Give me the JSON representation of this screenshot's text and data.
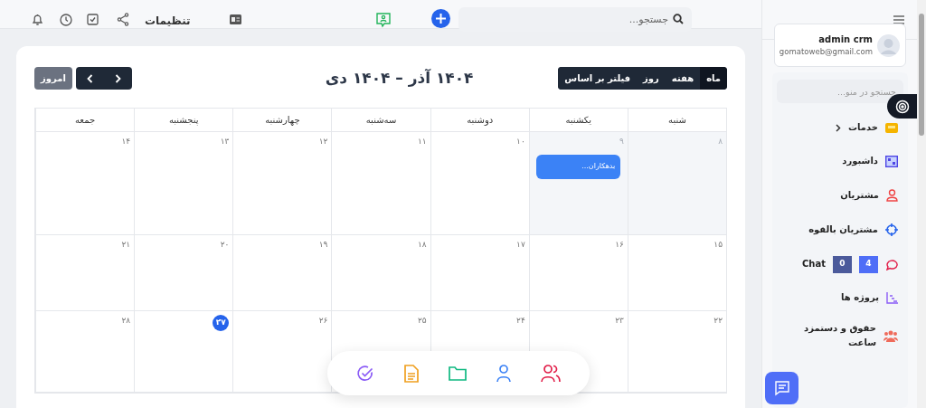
{
  "topbar": {
    "search": {
      "placeholder": "جستجو..."
    },
    "settings_label": "تنظیمات"
  },
  "calendar": {
    "title": "۱۴۰۴ آذر – ۱۴۰۴ دی",
    "today_button": {
      "label": "امروز",
      "disabled": true
    },
    "views": [
      {
        "label": "ماه",
        "selected": true
      },
      {
        "label": "هفته",
        "selected": false
      },
      {
        "label": "روز",
        "selected": false
      },
      {
        "label": "فیلتر بر اساس",
        "selected": false
      }
    ],
    "weekdays": [
      "شنبه",
      "یکشنبه",
      "دوشنبه",
      "سه‌شنبه",
      "چهارشنبه",
      "پنجشنبه",
      "جمعه"
    ],
    "weeks": [
      [
        {
          "day": "۸",
          "muted": true,
          "today": false
        },
        {
          "day": "۹",
          "muted": true,
          "today": false,
          "events": [
            "بدهکاران..."
          ]
        },
        {
          "day": "۱۰",
          "muted": false,
          "today": false
        },
        {
          "day": "۱۱",
          "muted": false,
          "today": false
        },
        {
          "day": "۱۲",
          "muted": false,
          "today": false
        },
        {
          "day": "۱۳",
          "muted": false,
          "today": false
        },
        {
          "day": "۱۴",
          "muted": false,
          "today": false
        }
      ],
      [
        {
          "day": "۱۵",
          "muted": false,
          "today": false
        },
        {
          "day": "۱۶",
          "muted": false,
          "today": false
        },
        {
          "day": "۱۷",
          "muted": false,
          "today": false
        },
        {
          "day": "۱۸",
          "muted": false,
          "today": false
        },
        {
          "day": "۱۹",
          "muted": false,
          "today": false
        },
        {
          "day": "۲۰",
          "muted": false,
          "today": false
        },
        {
          "day": "۲۱",
          "muted": false,
          "today": false
        }
      ],
      [
        {
          "day": "۲۲",
          "muted": false,
          "today": false
        },
        {
          "day": "۲۳",
          "muted": false,
          "today": false
        },
        {
          "day": "۲۴",
          "muted": false,
          "today": false
        },
        {
          "day": "۲۵",
          "muted": false,
          "today": false
        },
        {
          "day": "۲۶",
          "muted": false,
          "today": false
        },
        {
          "day": "۲۷",
          "muted": false,
          "today": true
        },
        {
          "day": "۲۸",
          "muted": false,
          "today": false
        }
      ]
    ]
  },
  "sidebar": {
    "user": {
      "name": "admin crm",
      "email": "gomatoweb@gmail.com"
    },
    "search": {
      "placeholder": "جستجو در منو..."
    },
    "items": [
      {
        "label": "خدمات",
        "expandable": true
      },
      {
        "label": "داشبورد",
        "expandable": false
      },
      {
        "label": "مشتریان",
        "expandable": false
      },
      {
        "label": "مشتریان بالقوه",
        "expandable": false
      },
      {
        "label": "Chat",
        "expandable": false,
        "badges": [
          {
            "text": "4",
            "color": "#4f6ef7"
          },
          {
            "text": "0",
            "color": "#4b5a9b"
          }
        ]
      },
      {
        "label": "پروژه ها",
        "expandable": false
      },
      {
        "label": "حقوق و دستمزد ساعت",
        "expandable": false
      }
    ]
  }
}
